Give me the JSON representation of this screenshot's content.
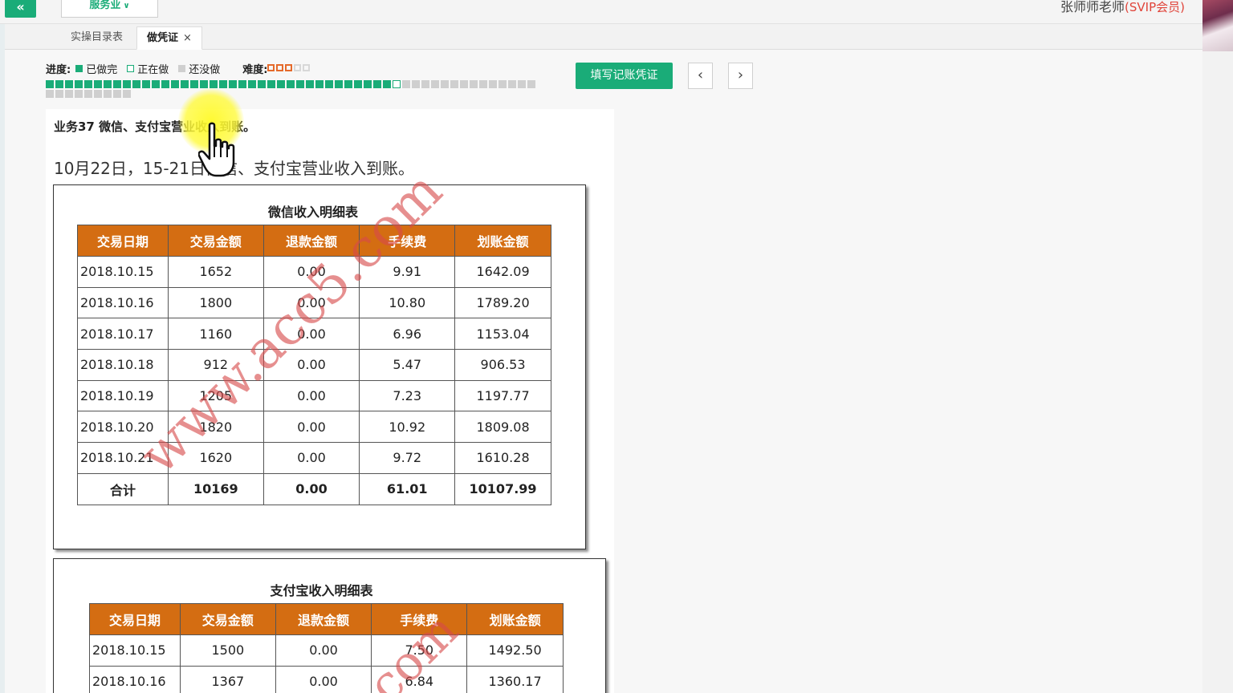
{
  "topbar": {
    "back_label": "«",
    "dept_label": "服务业",
    "user_name": "张师师老师",
    "user_badge": "(SVIP会员)"
  },
  "tabs": [
    {
      "label": "实操目录表"
    },
    {
      "label": "做凭证",
      "close": "×"
    }
  ],
  "progress": {
    "label": "进度:",
    "legend": {
      "done": "已做完",
      "doing": "正在做",
      "todo": "还没做"
    },
    "difficulty_label": "难度:",
    "difficulty_stars": 3,
    "difficulty_max": 5,
    "total_tasks": 60,
    "done_tasks": 36,
    "current_task": 37
  },
  "actions": {
    "fill_voucher": "填写记账凭证",
    "prev": "‹",
    "next": "›"
  },
  "business": {
    "title": "业务37 微信、支付宝营业收入到账。",
    "description": "10月22日，15-21日微信、支付宝营业收入到账。"
  },
  "wechat_table": {
    "title": "微信收入明细表",
    "headers": [
      "交易日期",
      "交易金额",
      "退款金额",
      "手续费",
      "划账金额"
    ],
    "rows": [
      [
        "2018.10.15",
        "1652",
        "0.00",
        "9.91",
        "1642.09"
      ],
      [
        "2018.10.16",
        "1800",
        "0.00",
        "10.80",
        "1789.20"
      ],
      [
        "2018.10.17",
        "1160",
        "0.00",
        "6.96",
        "1153.04"
      ],
      [
        "2018.10.18",
        "912",
        "0.00",
        "5.47",
        "906.53"
      ],
      [
        "2018.10.19",
        "1205",
        "0.00",
        "7.23",
        "1197.77"
      ],
      [
        "2018.10.20",
        "1820",
        "0.00",
        "10.92",
        "1809.08"
      ],
      [
        "2018.10.21",
        "1620",
        "0.00",
        "9.72",
        "1610.28"
      ]
    ],
    "total": [
      "合计",
      "10169",
      "0.00",
      "61.01",
      "10107.99"
    ]
  },
  "alipay_table": {
    "title": "支付宝收入明细表",
    "headers": [
      "交易日期",
      "交易金额",
      "退款金额",
      "手续费",
      "划账金额"
    ],
    "rows": [
      [
        "2018.10.15",
        "1500",
        "0.00",
        "7.50",
        "1492.50"
      ],
      [
        "2018.10.16",
        "1367",
        "0.00",
        "6.84",
        "1360.17"
      ]
    ]
  },
  "watermark": {
    "text1": "www.acc5.com",
    "text2": "com"
  }
}
